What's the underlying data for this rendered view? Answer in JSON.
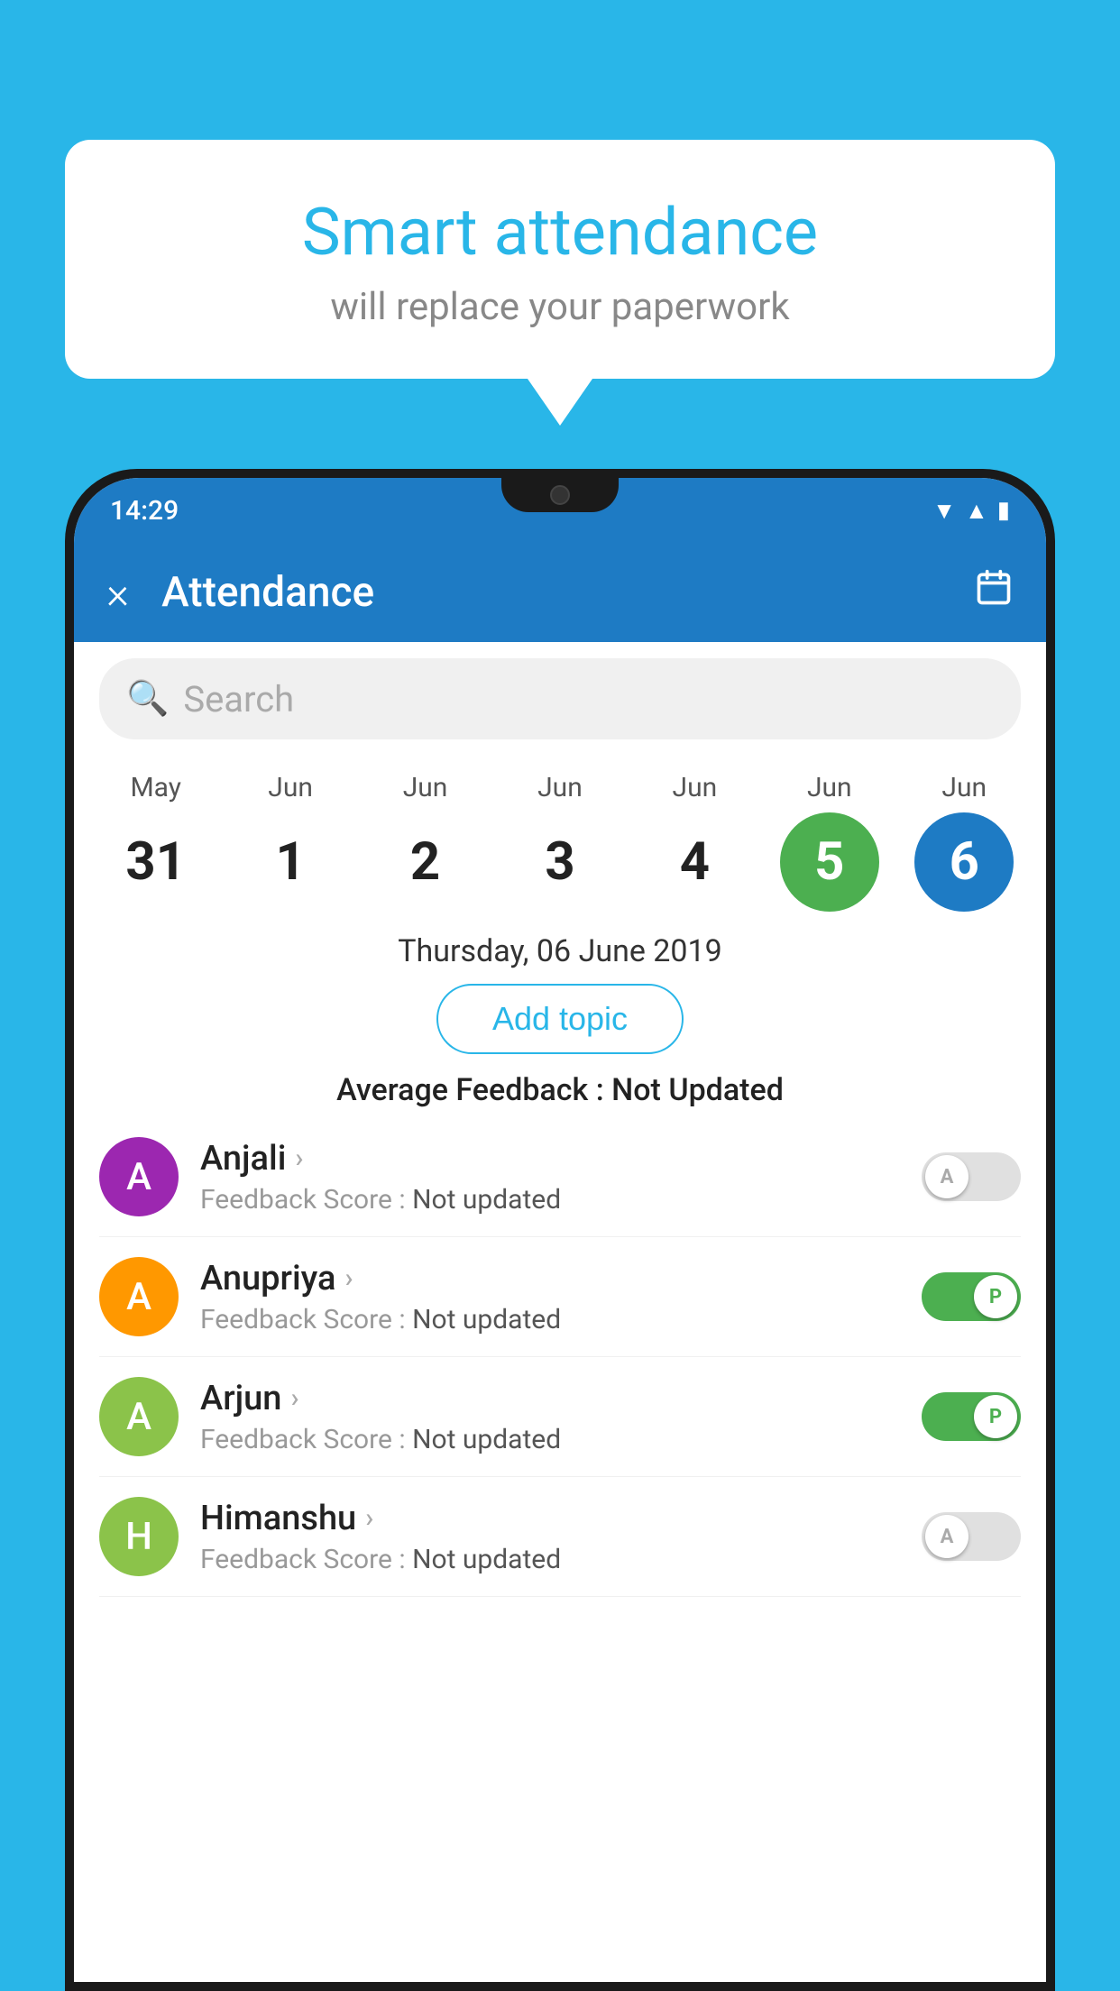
{
  "background_color": "#29b6e8",
  "speech_bubble": {
    "title": "Smart attendance",
    "subtitle": "will replace your paperwork"
  },
  "status_bar": {
    "time": "14:29",
    "icons": [
      "wifi",
      "signal",
      "battery"
    ]
  },
  "toolbar": {
    "title": "Attendance",
    "close_label": "×",
    "calendar_icon": "📅"
  },
  "search": {
    "placeholder": "Search"
  },
  "calendar": {
    "days": [
      {
        "month": "May",
        "num": "31",
        "state": "normal"
      },
      {
        "month": "Jun",
        "num": "1",
        "state": "normal"
      },
      {
        "month": "Jun",
        "num": "2",
        "state": "normal"
      },
      {
        "month": "Jun",
        "num": "3",
        "state": "normal"
      },
      {
        "month": "Jun",
        "num": "4",
        "state": "normal"
      },
      {
        "month": "Jun",
        "num": "5",
        "state": "today"
      },
      {
        "month": "Jun",
        "num": "6",
        "state": "selected"
      }
    ]
  },
  "selected_date": "Thursday, 06 June 2019",
  "add_topic_label": "Add topic",
  "avg_feedback_label": "Average Feedback :",
  "avg_feedback_value": "Not Updated",
  "students": [
    {
      "name": "Anjali",
      "initial": "A",
      "avatar_color": "#9c27b0",
      "score_label": "Feedback Score :",
      "score_value": "Not updated",
      "toggle": "off"
    },
    {
      "name": "Anupriya",
      "initial": "A",
      "avatar_color": "#ff9800",
      "score_label": "Feedback Score :",
      "score_value": "Not updated",
      "toggle": "on"
    },
    {
      "name": "Arjun",
      "initial": "A",
      "avatar_color": "#8bc34a",
      "score_label": "Feedback Score :",
      "score_value": "Not updated",
      "toggle": "on"
    },
    {
      "name": "Himanshu",
      "initial": "H",
      "avatar_color": "#8bc34a",
      "score_label": "Feedback Score :",
      "score_value": "Not updated",
      "toggle": "off"
    }
  ]
}
